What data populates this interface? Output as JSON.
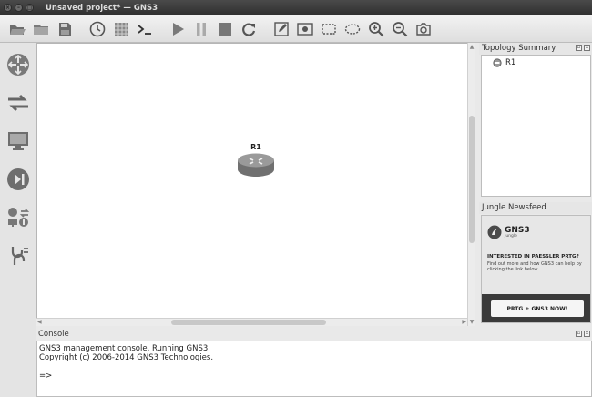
{
  "window": {
    "title": "Unsaved project* — GNS3",
    "controls": [
      "close",
      "minimize",
      "maximize"
    ]
  },
  "toolbar": {
    "buttons": [
      {
        "name": "open-project",
        "icon": "folder-open-icon"
      },
      {
        "name": "open-file",
        "icon": "folder-icon"
      },
      {
        "name": "save-project",
        "icon": "save-icon"
      },
      {
        "name": "snapshot",
        "icon": "clock-icon"
      },
      {
        "name": "show-interface-labels",
        "icon": "grid-icon"
      },
      {
        "name": "console-connect-all",
        "icon": "terminal-icon"
      },
      {
        "name": "start-all",
        "icon": "play-icon"
      },
      {
        "name": "suspend-all",
        "icon": "pause-icon"
      },
      {
        "name": "stop-all",
        "icon": "stop-icon"
      },
      {
        "name": "reload-all",
        "icon": "reload-icon"
      },
      {
        "name": "add-note",
        "icon": "note-icon"
      },
      {
        "name": "insert-image",
        "icon": "image-icon"
      },
      {
        "name": "draw-rectangle",
        "icon": "rectangle-icon"
      },
      {
        "name": "draw-ellipse",
        "icon": "ellipse-icon"
      },
      {
        "name": "zoom-in",
        "icon": "zoom-in-icon"
      },
      {
        "name": "zoom-out",
        "icon": "zoom-out-icon"
      },
      {
        "name": "screenshot",
        "icon": "camera-icon"
      }
    ]
  },
  "devices_toolbar": {
    "buttons": [
      {
        "name": "routers",
        "icon": "router-icon"
      },
      {
        "name": "switches",
        "icon": "switch-icon"
      },
      {
        "name": "end-devices",
        "icon": "monitor-icon"
      },
      {
        "name": "security-devices",
        "icon": "security-icon"
      },
      {
        "name": "all-devices",
        "icon": "all-devices-icon"
      },
      {
        "name": "add-link",
        "icon": "cable-icon"
      }
    ]
  },
  "canvas": {
    "nodes": [
      {
        "label": "R1",
        "icon": "router-icon"
      }
    ]
  },
  "topology_summary": {
    "title": "Topology Summary",
    "items": [
      {
        "label": "R1",
        "status": "stopped"
      }
    ]
  },
  "jungle_newsfeed": {
    "title": "Jungle Newsfeed",
    "logo_text": "GNS3",
    "logo_sub": "Jungle",
    "heading": "INTERESTED IN PAESSLER PRTG?",
    "body": "Find out more and how GNS3 can help by clicking the link below.",
    "button_label": "PRTG + GNS3 NOW!"
  },
  "console": {
    "title": "Console",
    "lines": [
      "GNS3 management console. Running GNS3",
      "Copyright (c) 2006-2014 GNS3 Technologies."
    ],
    "prompt": "=>"
  },
  "colors": {
    "titlebar": "#3a3a3a",
    "canvas_bg": "#ffffff",
    "router_body": "#8a8a8a",
    "newsfeed_band": "#3a3a3a"
  }
}
